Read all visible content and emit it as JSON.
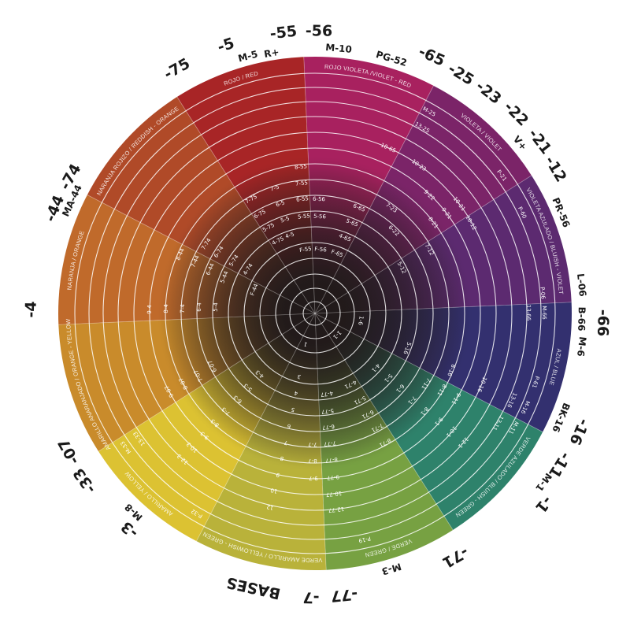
{
  "wheel": {
    "center_color": "#2a2020",
    "sectors": [
      {
        "name": "ROJO VIOLETA /VIOLET - RED",
        "color": "#a8215f"
      },
      {
        "name": "VIOLETA / VIOLET",
        "color": "#7b2468"
      },
      {
        "name": "VIOLETA AZULADO / BLUISH - VIOLET",
        "color": "#5c2a70"
      },
      {
        "name": "AZUL / BLUE",
        "color": "#33306f"
      },
      {
        "name": "VERDE AZULADO / BLUISH - GREEN",
        "color": "#2e826b"
      },
      {
        "name": "VERDE / GREEN",
        "color": "#77a142"
      },
      {
        "name": "VERDE AMARILLO / YELLOWISH - GREEN",
        "color": "#b9b23a"
      },
      {
        "name": "AMARILLO / YELLOW",
        "color": "#dcc232"
      },
      {
        "name": "AMARILLO ANARANJADO / ORANGE - YELLOW",
        "color": "#c98b2b"
      },
      {
        "name": "NARANJA / ORANGE",
        "color": "#c06a2b"
      },
      {
        "name": "NARANJA ROJIZO / REDDISH - ORANGE",
        "color": "#b04a28"
      },
      {
        "name": "ROJO / RED",
        "color": "#a82526"
      }
    ],
    "inner_labels": [
      "8-55",
      "7-55",
      "7-5",
      "7-75",
      "6-55",
      "6-56",
      "6-5",
      "6-75",
      "5-55",
      "5-56",
      "5-5",
      "5-75",
      "4-5",
      "4-75",
      "F-55",
      "F-56",
      "7-74",
      "6-74",
      "5-74",
      "4-74",
      "F-44",
      "8-44",
      "7-44",
      "6-44",
      "5-44",
      "9-4",
      "8-4",
      "7-4",
      "6-4",
      "5-4",
      "10-65",
      "6-65",
      "5-65",
      "4-65",
      "F-65",
      "M-25",
      "13-25",
      "10-23",
      "9-22",
      "7-23",
      "6-22",
      "10-21",
      "9-21",
      "8-21",
      "P-21",
      "5-12",
      "10-12",
      "7-12",
      "P-60",
      "P-06",
      "13-66",
      "M-66",
      "1-6",
      "5-16",
      "8-16",
      "10-16",
      "13-16",
      "M-16",
      "P-61",
      "1-1",
      "4-1",
      "5-1",
      "6-1",
      "7-1",
      "8-1",
      "9-1",
      "10-1",
      "12-1",
      "7-11",
      "8-11",
      "9-11",
      "13-11",
      "M-11",
      "4-71",
      "5-71",
      "6-71",
      "7-71",
      "8-71",
      "4-77",
      "5-77",
      "6-77",
      "7-77",
      "8-77",
      "9-77",
      "10-77",
      "12-77",
      "P-19",
      "1",
      "3",
      "4",
      "5",
      "6",
      "7",
      "8",
      "9",
      "10",
      "12",
      "7-7",
      "8-7",
      "9-7",
      "4-3",
      "5-3",
      "6-3",
      "7-3",
      "8-3",
      "9-3",
      "10-3",
      "12-3",
      "13-33",
      "M-33",
      "P-32",
      "6-07",
      "7-07",
      "8-07",
      "9-07"
    ],
    "outer_labels": [
      "-75",
      "-5",
      "M-5",
      "R+",
      "-55",
      "-56",
      "M-10",
      "PG-52",
      "-65",
      "-25",
      "-23",
      "-22",
      "V+",
      "-21",
      "-12",
      "PR-56",
      "L-06",
      "B-66",
      "-66",
      "M-6",
      "BK-16",
      "-16",
      "-11",
      "M-1",
      "-1",
      "-71",
      "M-3",
      "-77",
      "-7",
      "BASES",
      "M-8",
      "-3",
      "-33",
      "-07",
      "-4",
      "-44",
      "-74",
      "MA-44"
    ]
  }
}
